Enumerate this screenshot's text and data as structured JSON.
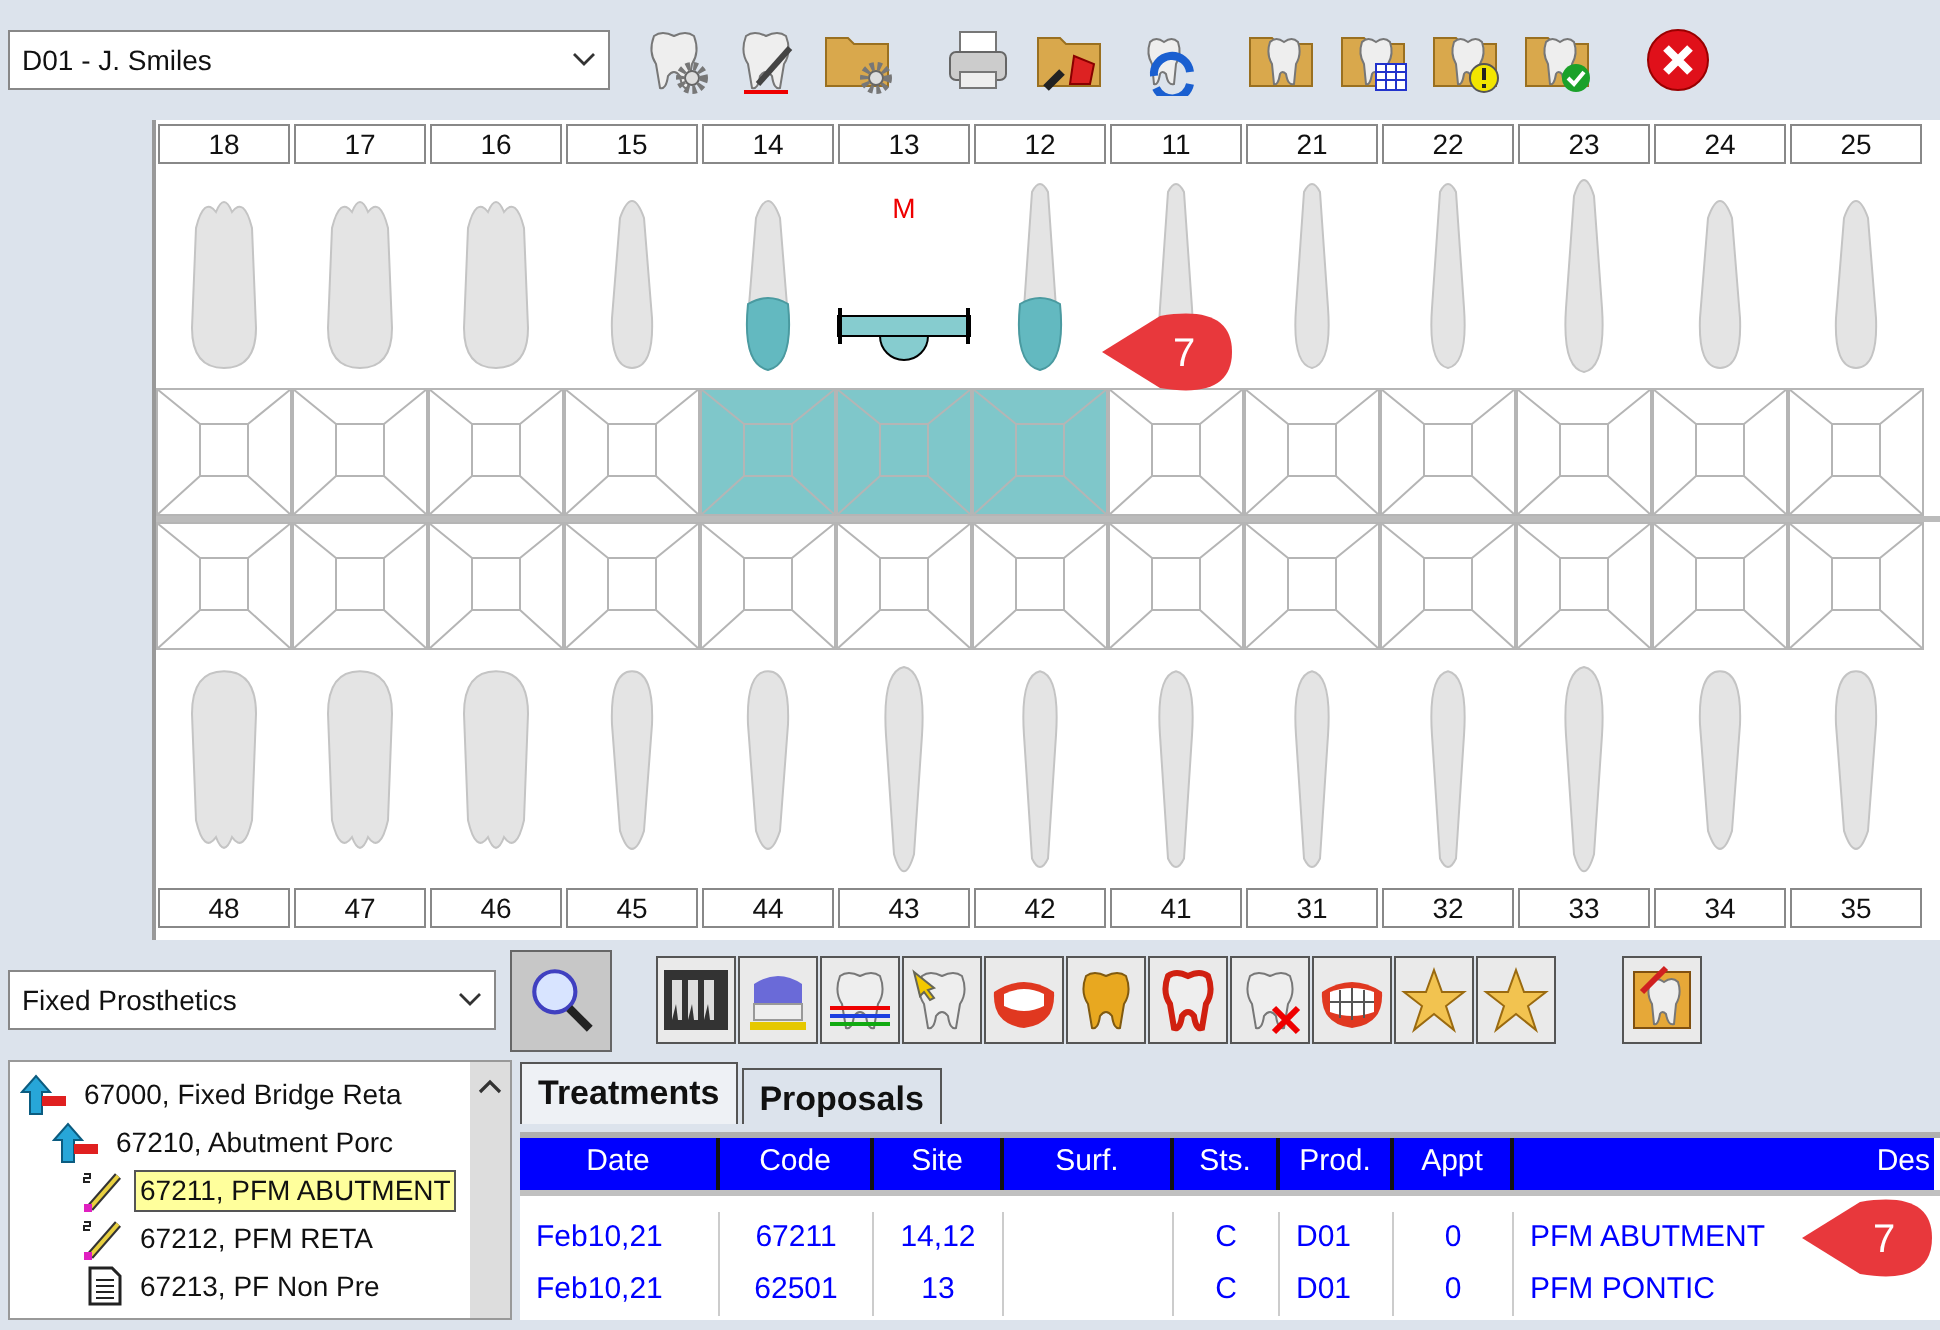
{
  "provider_dropdown": {
    "value": "D01 - J. Smiles"
  },
  "chart": {
    "upper_teeth": [
      {
        "number": "18",
        "selected": false,
        "kind": "natural"
      },
      {
        "number": "17",
        "selected": false,
        "kind": "natural"
      },
      {
        "number": "16",
        "selected": false,
        "kind": "natural"
      },
      {
        "number": "15",
        "selected": false,
        "kind": "natural"
      },
      {
        "number": "14",
        "selected": true,
        "kind": "abutment"
      },
      {
        "number": "13",
        "selected": true,
        "kind": "pontic",
        "marker": "M"
      },
      {
        "number": "12",
        "selected": true,
        "kind": "abutment"
      },
      {
        "number": "11",
        "selected": false,
        "kind": "natural"
      },
      {
        "number": "21",
        "selected": false,
        "kind": "natural"
      },
      {
        "number": "22",
        "selected": false,
        "kind": "natural"
      },
      {
        "number": "23",
        "selected": false,
        "kind": "natural"
      },
      {
        "number": "24",
        "selected": false,
        "kind": "natural"
      },
      {
        "number": "25",
        "selected": false,
        "kind": "natural"
      }
    ],
    "lower_teeth": [
      {
        "number": "48",
        "selected": false,
        "kind": "natural"
      },
      {
        "number": "47",
        "selected": false,
        "kind": "natural"
      },
      {
        "number": "46",
        "selected": false,
        "kind": "natural"
      },
      {
        "number": "45",
        "selected": false,
        "kind": "natural"
      },
      {
        "number": "44",
        "selected": false,
        "kind": "natural"
      },
      {
        "number": "43",
        "selected": false,
        "kind": "natural"
      },
      {
        "number": "42",
        "selected": false,
        "kind": "natural"
      },
      {
        "number": "41",
        "selected": false,
        "kind": "natural"
      },
      {
        "number": "31",
        "selected": false,
        "kind": "natural"
      },
      {
        "number": "32",
        "selected": false,
        "kind": "natural"
      },
      {
        "number": "33",
        "selected": false,
        "kind": "natural"
      },
      {
        "number": "34",
        "selected": false,
        "kind": "natural"
      },
      {
        "number": "35",
        "selected": false,
        "kind": "natural"
      }
    ]
  },
  "callouts": [
    {
      "text": "7"
    },
    {
      "text": "7"
    }
  ],
  "category_dropdown": {
    "value": "Fixed Prosthetics"
  },
  "procedure_tree": [
    {
      "label": "67000, Fixed Bridge Reta",
      "kind": "group",
      "selected": false,
      "children": [
        {
          "label": "67210, Abutment Porc",
          "kind": "group",
          "selected": false,
          "children": [
            {
              "label": "67211, PFM ABUTMENT",
              "kind": "procedure",
              "selected": true
            },
            {
              "label": "67212, PFM RETA",
              "kind": "procedure",
              "selected": false
            },
            {
              "label": "67213, PF Non Pre",
              "kind": "document",
              "selected": false
            }
          ]
        }
      ]
    }
  ],
  "tabs": [
    {
      "label": "Treatments",
      "selected": true
    },
    {
      "label": "Proposals",
      "selected": false
    }
  ],
  "table": {
    "columns": [
      "Date",
      "Code",
      "Site",
      "Surf.",
      "Sts.",
      "Prod.",
      "Appt",
      "Des"
    ],
    "rows": [
      [
        "Feb10,21",
        "67211",
        "14,12",
        "",
        "C",
        "D01",
        "0",
        "PFM ABUTMENT"
      ],
      [
        "Feb10,21",
        "62501",
        "13",
        "",
        "C",
        "D01",
        "0",
        "PFM PONTIC"
      ]
    ]
  }
}
